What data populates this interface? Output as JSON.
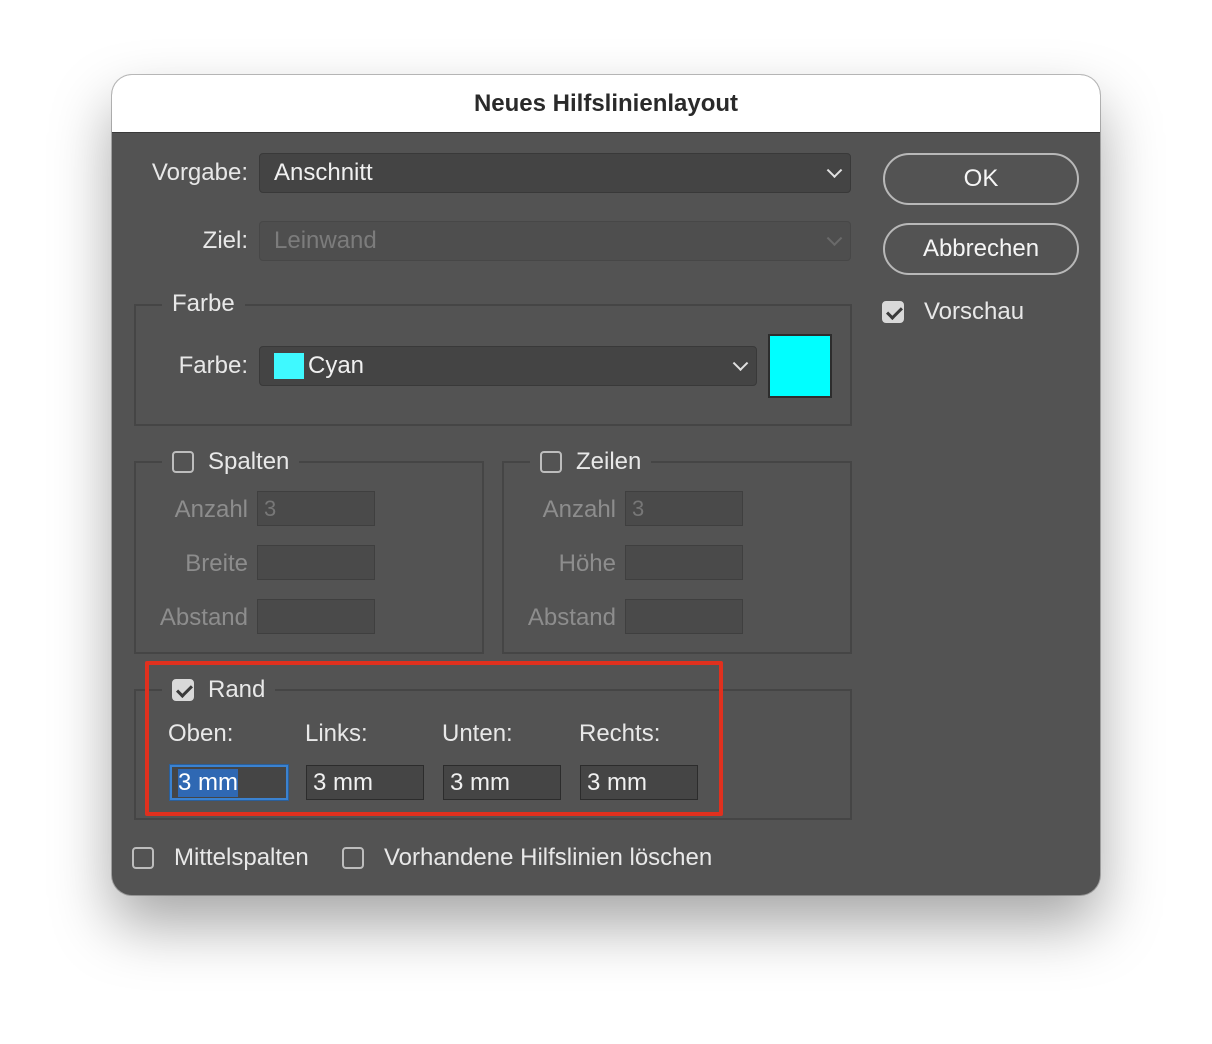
{
  "dialog": {
    "title": "Neues Hilfslinienlayout",
    "vorgabe_label": "Vorgabe:",
    "vorgabe_value": "Anschnitt",
    "ziel_label": "Ziel:",
    "ziel_value": "Leinwand"
  },
  "buttons": {
    "ok": "OK",
    "cancel": "Abbrechen"
  },
  "preview": {
    "label": "Vorschau",
    "checked": true
  },
  "farbe": {
    "group_label": "Farbe",
    "label": "Farbe:",
    "value": "Cyan",
    "swatch_color": "#00ffff"
  },
  "spalten": {
    "label": "Spalten",
    "checked": false,
    "anzahl_label": "Anzahl",
    "anzahl_value": "3",
    "breite_label": "Breite",
    "breite_value": "",
    "abstand_label": "Abstand",
    "abstand_value": ""
  },
  "zeilen": {
    "label": "Zeilen",
    "checked": false,
    "anzahl_label": "Anzahl",
    "anzahl_value": "3",
    "hoehe_label": "Höhe",
    "hoehe_value": "",
    "abstand_label": "Abstand",
    "abstand_value": ""
  },
  "rand": {
    "label": "Rand",
    "checked": true,
    "oben_label": "Oben:",
    "oben_value": "3 mm",
    "links_label": "Links:",
    "links_value": "3 mm",
    "unten_label": "Unten:",
    "unten_value": "3 mm",
    "rechts_label": "Rechts:",
    "rechts_value": "3 mm",
    "highlight_color": "#e0301e"
  },
  "options": {
    "mittelspalten_label": "Mittelspalten",
    "mittelspalten_checked": false,
    "loeschen_label": "Vorhandene Hilfslinien löschen",
    "loeschen_checked": false
  }
}
